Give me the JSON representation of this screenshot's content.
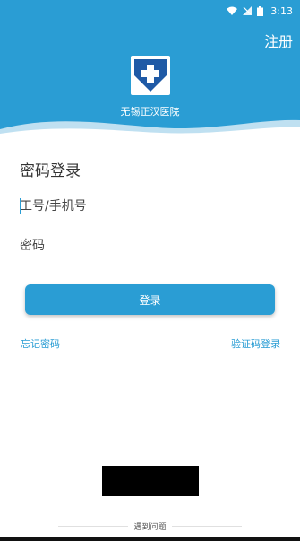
{
  "status_bar": {
    "time": "3:13"
  },
  "header": {
    "register_label": "注册",
    "hospital_name": "无锡正汉医院",
    "logo_icon": "hospital-cross-icon",
    "brand_color": "#2a9dd4"
  },
  "form": {
    "title": "密码登录",
    "account_placeholder": "工号/手机号",
    "password_placeholder": "密码",
    "login_label": "登录"
  },
  "links": {
    "forgot_password": "忘记密码",
    "sms_login": "验证码登录"
  },
  "help": {
    "label": "遇到问题"
  }
}
